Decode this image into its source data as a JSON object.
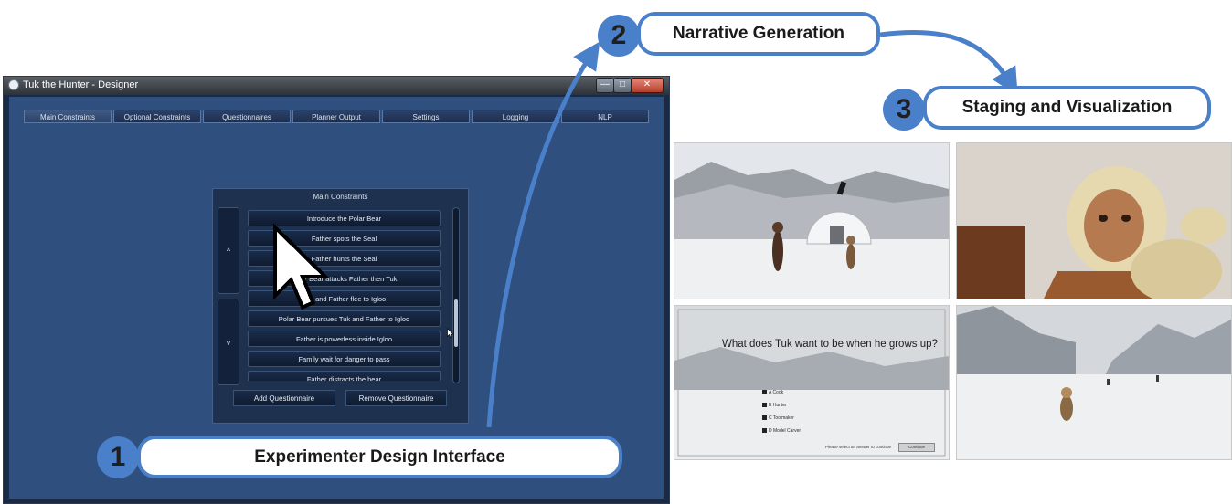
{
  "window": {
    "title": "Tuk the Hunter - Designer",
    "min": "—",
    "max": "□",
    "close": "✕"
  },
  "tabs": [
    "Main Constraints",
    "Optional Constraints",
    "Questionnaires",
    "Planner Output",
    "Settings",
    "Logging",
    "NLP"
  ],
  "panel": {
    "title": "Main Constraints",
    "up": "^",
    "down": "v",
    "items": [
      "Introduce the Polar Bear",
      "Father spots the Seal",
      "Father hunts the Seal",
      "Polar Bear attacks Father then Tuk",
      "Tuk and Father flee to Igloo",
      "Polar Bear pursues Tuk and Father to Igloo",
      "Father is powerless inside Igloo",
      "Family wait for danger to pass",
      "Father distracts the bear"
    ],
    "add_button": "Add Questionnaire",
    "remove_button": "Remove Questionnaire"
  },
  "callouts": {
    "step1": {
      "number": "1",
      "label": "Experimenter Design Interface"
    },
    "step2": {
      "number": "2",
      "label": "Narrative Generation"
    },
    "step3": {
      "number": "3",
      "label": "Staging and Visualization"
    }
  },
  "questionnaire": {
    "question": "What does Tuk want to be when he grows up?",
    "options": [
      "A  Cook",
      "B  Hunter",
      "C  Toolmaker",
      "D  Model Carver"
    ],
    "footer": "Please select an answer to continue",
    "continue": "Continue"
  },
  "colors": {
    "accent": "#4a7fc9",
    "window_bg": "#2f4f7e"
  }
}
